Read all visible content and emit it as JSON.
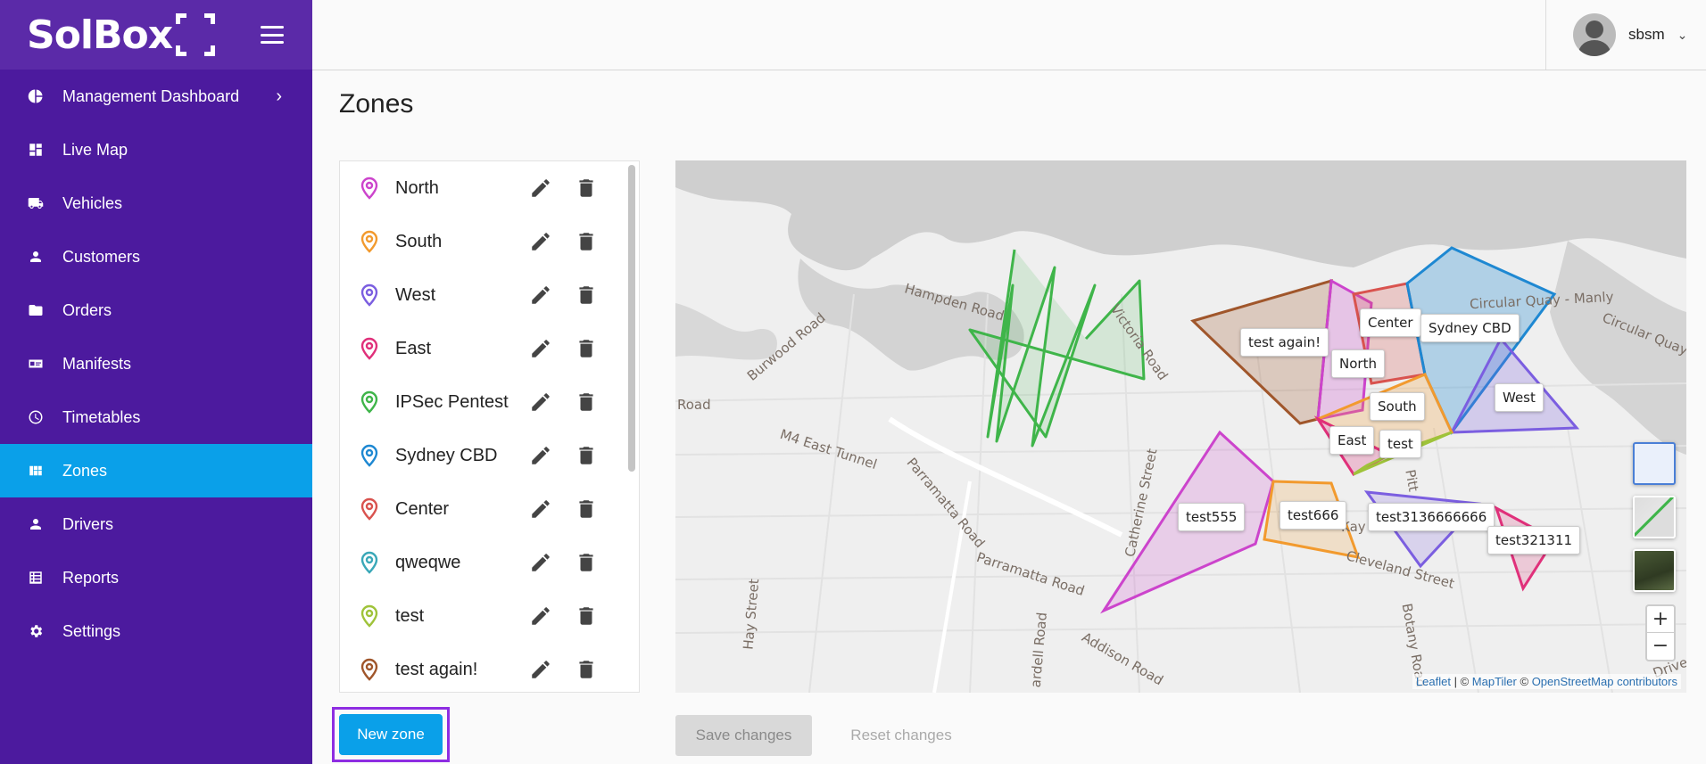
{
  "brand": {
    "name": "SolBox"
  },
  "nav": {
    "items": [
      {
        "label": "Management Dashboard",
        "icon": "pie-chart-icon",
        "has_chevron": true
      },
      {
        "label": "Live Map",
        "icon": "dashboard-icon"
      },
      {
        "label": "Vehicles",
        "icon": "truck-icon"
      },
      {
        "label": "Customers",
        "icon": "person-icon"
      },
      {
        "label": "Orders",
        "icon": "folder-icon"
      },
      {
        "label": "Manifests",
        "icon": "card-icon"
      },
      {
        "label": "Timetables",
        "icon": "clock-icon"
      },
      {
        "label": "Zones",
        "icon": "grid-icon",
        "active": true
      },
      {
        "label": "Drivers",
        "icon": "person-icon"
      },
      {
        "label": "Reports",
        "icon": "list-icon"
      },
      {
        "label": "Settings",
        "icon": "gear-icon"
      }
    ],
    "chevron": "›"
  },
  "user": {
    "name": "sbsm",
    "caret": "⌄"
  },
  "page": {
    "title": "Zones"
  },
  "zones": [
    {
      "name": "North",
      "color": "#cc44cc"
    },
    {
      "name": "South",
      "color": "#f29a2e"
    },
    {
      "name": "West",
      "color": "#7b5ee0"
    },
    {
      "name": "East",
      "color": "#e0307a"
    },
    {
      "name": "IPSec Pentest",
      "color": "#3fb54a"
    },
    {
      "name": "Sydney CBD",
      "color": "#1e88d2"
    },
    {
      "name": "Center",
      "color": "#d9534f"
    },
    {
      "name": "qweqwe",
      "color": "#3aa8b8"
    },
    {
      "name": "test",
      "color": "#9fc33a"
    },
    {
      "name": "test again!",
      "color": "#a0562b"
    }
  ],
  "map": {
    "labels": {
      "test_again": "test again!",
      "north": "North",
      "center": "Center",
      "sydney_cbd": "Sydney CBD",
      "west": "West",
      "south": "South",
      "east": "East",
      "test": "test",
      "test555": "test555",
      "test666": "test666",
      "test3136666666": "test3136666666",
      "test321311": "test321311"
    },
    "streets": {
      "hampden": "Hampden Road",
      "burwood": "Burwood Road",
      "victoria": "Victoria Road",
      "m4": "M4 East Tunnel",
      "parramatta1": "Parramatta Road",
      "parramatta2": "Parramatta Road",
      "catherine": "Catherine Street",
      "cleveland": "Cleveland Street",
      "circular1": "Circular Quay - Manly",
      "circular2": "Circular Quay - F",
      "hay": "Hay Street",
      "addison": "Addison Road",
      "botany": "Botany Road",
      "road": "Road",
      "drive": "Drive",
      "kay": "Kay",
      "ey": "ey",
      "pitt": "Pitt",
      "ardell": "ardell Road"
    },
    "attribution": {
      "leaflet": "Leaflet",
      "sep": " | © ",
      "maptiler": "MapTiler",
      "sep2": " © ",
      "osm": "OpenStreetMap contributors"
    },
    "zoom_in": "+",
    "zoom_out": "−"
  },
  "actions": {
    "new_zone": "New zone",
    "save": "Save changes",
    "reset": "Reset changes"
  }
}
